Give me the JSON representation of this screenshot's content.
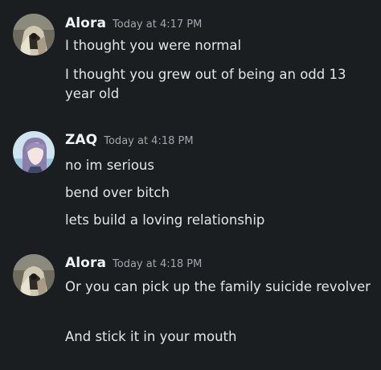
{
  "groups": [
    {
      "author": "Alora",
      "timestamp": "Today at 4:17 PM",
      "avatar_icon": "alora-avatar",
      "messages": [
        "I thought you were normal",
        "I thought you grew out of being an odd 13 year old"
      ]
    },
    {
      "author": "ZAQ",
      "timestamp": "Today at 4:18 PM",
      "avatar_icon": "zaq-avatar",
      "messages": [
        "no im serious",
        "bend over bitch",
        "lets build a loving relationship"
      ]
    },
    {
      "author": "Alora",
      "timestamp": "Today at 4:18 PM",
      "avatar_icon": "alora-avatar",
      "messages": [
        "Or you can pick up the family suicide revolver",
        "And stick it in your mouth"
      ]
    }
  ],
  "colors": {
    "background": "#1b1e21",
    "username": "#f2f3f5",
    "timestamp": "#a3a6aa",
    "message": "#e3e5e8"
  }
}
